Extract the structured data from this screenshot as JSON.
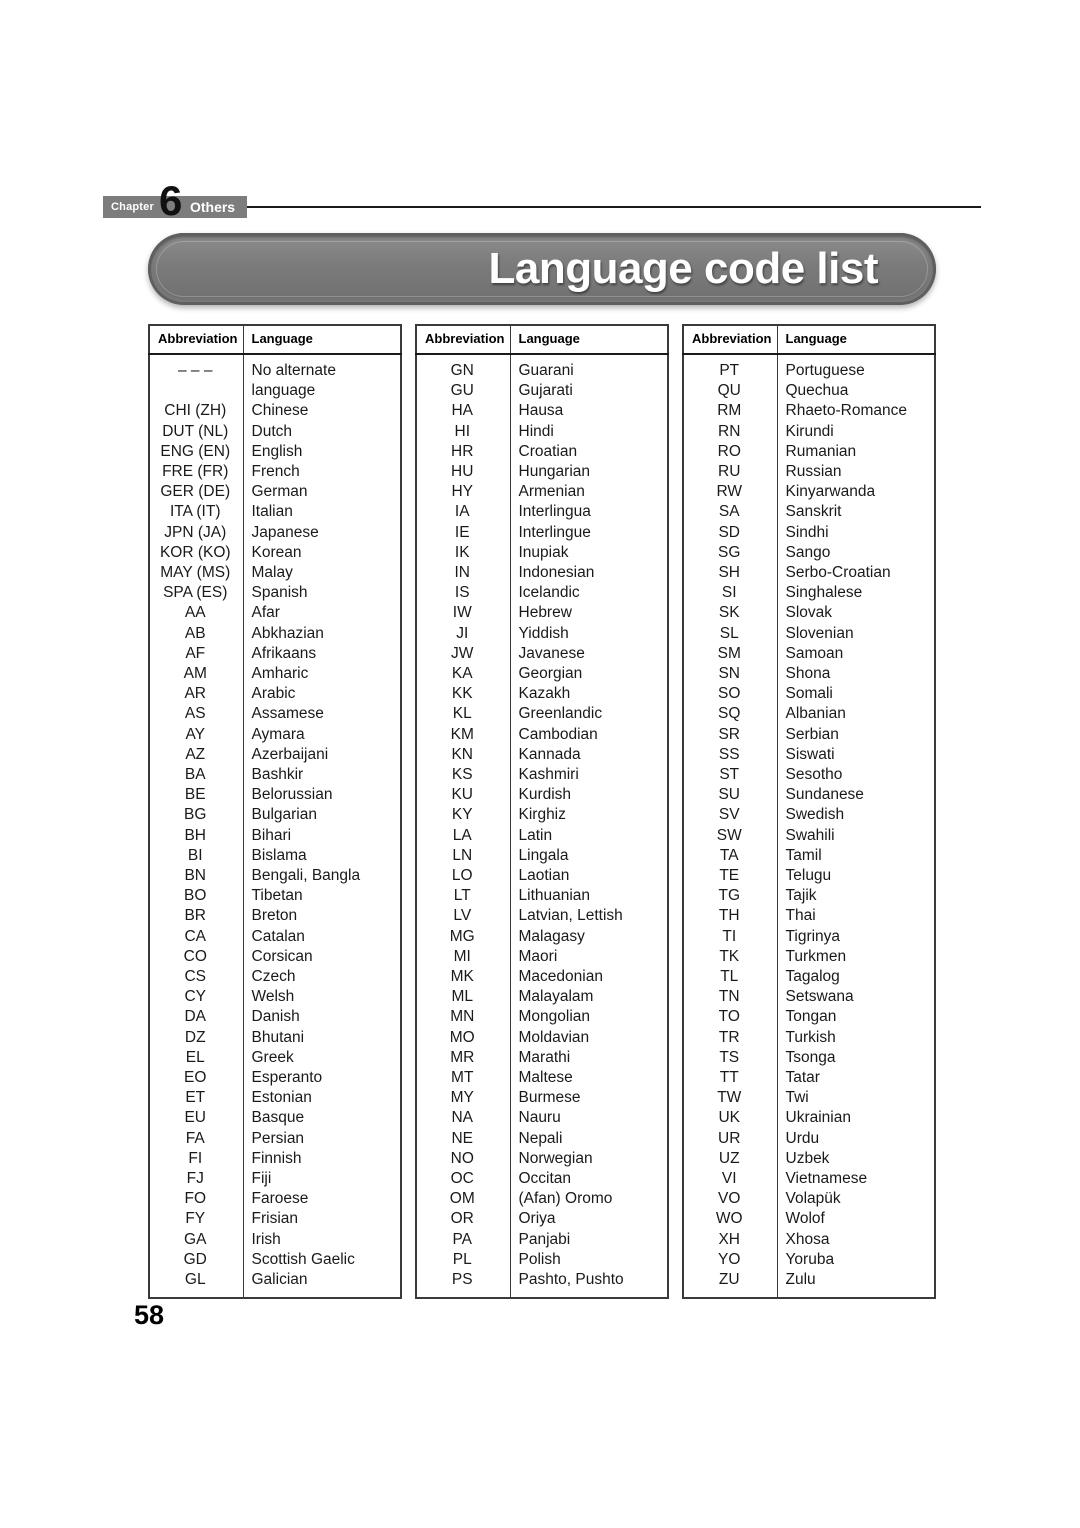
{
  "chapter": {
    "label": "Chapter",
    "number": "6",
    "section": "Others"
  },
  "page_title": "Language code list",
  "page_number": "58",
  "table_headers": {
    "abbreviation": "Abbreviation",
    "language": "Language"
  },
  "columns": [
    {
      "rows": [
        {
          "abbr": "– – –",
          "lang": "No alternate"
        },
        {
          "abbr": "",
          "lang": "language"
        },
        {
          "abbr": "CHI (ZH)",
          "lang": "Chinese"
        },
        {
          "abbr": "DUT (NL)",
          "lang": "Dutch"
        },
        {
          "abbr": "ENG (EN)",
          "lang": "English"
        },
        {
          "abbr": "FRE (FR)",
          "lang": "French"
        },
        {
          "abbr": "GER (DE)",
          "lang": "German"
        },
        {
          "abbr": "ITA (IT)",
          "lang": "Italian"
        },
        {
          "abbr": "JPN (JA)",
          "lang": "Japanese"
        },
        {
          "abbr": "KOR (KO)",
          "lang": "Korean"
        },
        {
          "abbr": "MAY (MS)",
          "lang": "Malay"
        },
        {
          "abbr": "SPA (ES)",
          "lang": "Spanish"
        },
        {
          "abbr": "AA",
          "lang": "Afar"
        },
        {
          "abbr": "AB",
          "lang": "Abkhazian"
        },
        {
          "abbr": "AF",
          "lang": "Afrikaans"
        },
        {
          "abbr": "AM",
          "lang": "Amharic"
        },
        {
          "abbr": "AR",
          "lang": "Arabic"
        },
        {
          "abbr": "AS",
          "lang": "Assamese"
        },
        {
          "abbr": "AY",
          "lang": "Aymara"
        },
        {
          "abbr": "AZ",
          "lang": "Azerbaijani"
        },
        {
          "abbr": "BA",
          "lang": "Bashkir"
        },
        {
          "abbr": "BE",
          "lang": "Belorussian"
        },
        {
          "abbr": "BG",
          "lang": "Bulgarian"
        },
        {
          "abbr": "BH",
          "lang": "Bihari"
        },
        {
          "abbr": "BI",
          "lang": "Bislama"
        },
        {
          "abbr": "BN",
          "lang": "Bengali, Bangla"
        },
        {
          "abbr": "BO",
          "lang": "Tibetan"
        },
        {
          "abbr": "BR",
          "lang": "Breton"
        },
        {
          "abbr": "CA",
          "lang": "Catalan"
        },
        {
          "abbr": "CO",
          "lang": "Corsican"
        },
        {
          "abbr": "CS",
          "lang": "Czech"
        },
        {
          "abbr": "CY",
          "lang": "Welsh"
        },
        {
          "abbr": "DA",
          "lang": "Danish"
        },
        {
          "abbr": "DZ",
          "lang": "Bhutani"
        },
        {
          "abbr": "EL",
          "lang": "Greek"
        },
        {
          "abbr": "EO",
          "lang": "Esperanto"
        },
        {
          "abbr": "ET",
          "lang": "Estonian"
        },
        {
          "abbr": "EU",
          "lang": "Basque"
        },
        {
          "abbr": "FA",
          "lang": "Persian"
        },
        {
          "abbr": "FI",
          "lang": "Finnish"
        },
        {
          "abbr": "FJ",
          "lang": "Fiji"
        },
        {
          "abbr": "FO",
          "lang": "Faroese"
        },
        {
          "abbr": "FY",
          "lang": "Frisian"
        },
        {
          "abbr": "GA",
          "lang": "Irish"
        },
        {
          "abbr": "GD",
          "lang": "Scottish Gaelic"
        },
        {
          "abbr": "GL",
          "lang": "Galician"
        }
      ]
    },
    {
      "rows": [
        {
          "abbr": "GN",
          "lang": "Guarani"
        },
        {
          "abbr": "GU",
          "lang": "Gujarati"
        },
        {
          "abbr": "HA",
          "lang": "Hausa"
        },
        {
          "abbr": "HI",
          "lang": "Hindi"
        },
        {
          "abbr": "HR",
          "lang": "Croatian"
        },
        {
          "abbr": "HU",
          "lang": "Hungarian"
        },
        {
          "abbr": "HY",
          "lang": "Armenian"
        },
        {
          "abbr": "IA",
          "lang": "Interlingua"
        },
        {
          "abbr": "IE",
          "lang": "Interlingue"
        },
        {
          "abbr": "IK",
          "lang": "Inupiak"
        },
        {
          "abbr": "IN",
          "lang": "Indonesian"
        },
        {
          "abbr": "IS",
          "lang": "Icelandic"
        },
        {
          "abbr": "IW",
          "lang": "Hebrew"
        },
        {
          "abbr": "JI",
          "lang": "Yiddish"
        },
        {
          "abbr": "JW",
          "lang": "Javanese"
        },
        {
          "abbr": "KA",
          "lang": "Georgian"
        },
        {
          "abbr": "KK",
          "lang": "Kazakh"
        },
        {
          "abbr": "KL",
          "lang": "Greenlandic"
        },
        {
          "abbr": "KM",
          "lang": "Cambodian"
        },
        {
          "abbr": "KN",
          "lang": "Kannada"
        },
        {
          "abbr": "KS",
          "lang": "Kashmiri"
        },
        {
          "abbr": "KU",
          "lang": "Kurdish"
        },
        {
          "abbr": "KY",
          "lang": "Kirghiz"
        },
        {
          "abbr": "LA",
          "lang": "Latin"
        },
        {
          "abbr": "LN",
          "lang": "Lingala"
        },
        {
          "abbr": "LO",
          "lang": "Laotian"
        },
        {
          "abbr": "LT",
          "lang": "Lithuanian"
        },
        {
          "abbr": "LV",
          "lang": "Latvian, Lettish"
        },
        {
          "abbr": "MG",
          "lang": "Malagasy"
        },
        {
          "abbr": "MI",
          "lang": "Maori"
        },
        {
          "abbr": "MK",
          "lang": "Macedonian"
        },
        {
          "abbr": "ML",
          "lang": "Malayalam"
        },
        {
          "abbr": "MN",
          "lang": "Mongolian"
        },
        {
          "abbr": "MO",
          "lang": "Moldavian"
        },
        {
          "abbr": "MR",
          "lang": "Marathi"
        },
        {
          "abbr": "MT",
          "lang": "Maltese"
        },
        {
          "abbr": "MY",
          "lang": "Burmese"
        },
        {
          "abbr": "NA",
          "lang": "Nauru"
        },
        {
          "abbr": "NE",
          "lang": "Nepali"
        },
        {
          "abbr": "NO",
          "lang": "Norwegian"
        },
        {
          "abbr": "OC",
          "lang": "Occitan"
        },
        {
          "abbr": "OM",
          "lang": "(Afan) Oromo"
        },
        {
          "abbr": "OR",
          "lang": "Oriya"
        },
        {
          "abbr": "PA",
          "lang": "Panjabi"
        },
        {
          "abbr": "PL",
          "lang": "Polish"
        },
        {
          "abbr": "PS",
          "lang": "Pashto, Pushto"
        }
      ]
    },
    {
      "rows": [
        {
          "abbr": "PT",
          "lang": "Portuguese"
        },
        {
          "abbr": "QU",
          "lang": "Quechua"
        },
        {
          "abbr": "RM",
          "lang": "Rhaeto-Romance"
        },
        {
          "abbr": "RN",
          "lang": "Kirundi"
        },
        {
          "abbr": "RO",
          "lang": "Rumanian"
        },
        {
          "abbr": "RU",
          "lang": "Russian"
        },
        {
          "abbr": "RW",
          "lang": "Kinyarwanda"
        },
        {
          "abbr": "SA",
          "lang": "Sanskrit"
        },
        {
          "abbr": "SD",
          "lang": "Sindhi"
        },
        {
          "abbr": "SG",
          "lang": "Sango"
        },
        {
          "abbr": "SH",
          "lang": "Serbo-Croatian"
        },
        {
          "abbr": "SI",
          "lang": "Singhalese"
        },
        {
          "abbr": "SK",
          "lang": "Slovak"
        },
        {
          "abbr": "SL",
          "lang": "Slovenian"
        },
        {
          "abbr": "SM",
          "lang": "Samoan"
        },
        {
          "abbr": "SN",
          "lang": "Shona"
        },
        {
          "abbr": "SO",
          "lang": "Somali"
        },
        {
          "abbr": "SQ",
          "lang": "Albanian"
        },
        {
          "abbr": "SR",
          "lang": "Serbian"
        },
        {
          "abbr": "SS",
          "lang": "Siswati"
        },
        {
          "abbr": "ST",
          "lang": "Sesotho"
        },
        {
          "abbr": "SU",
          "lang": "Sundanese"
        },
        {
          "abbr": "SV",
          "lang": "Swedish"
        },
        {
          "abbr": "SW",
          "lang": "Swahili"
        },
        {
          "abbr": "TA",
          "lang": "Tamil"
        },
        {
          "abbr": "TE",
          "lang": "Telugu"
        },
        {
          "abbr": "TG",
          "lang": "Tajik"
        },
        {
          "abbr": "TH",
          "lang": "Thai"
        },
        {
          "abbr": "TI",
          "lang": "Tigrinya"
        },
        {
          "abbr": "TK",
          "lang": "Turkmen"
        },
        {
          "abbr": "TL",
          "lang": "Tagalog"
        },
        {
          "abbr": "TN",
          "lang": "Setswana"
        },
        {
          "abbr": "TO",
          "lang": "Tongan"
        },
        {
          "abbr": "TR",
          "lang": "Turkish"
        },
        {
          "abbr": "TS",
          "lang": "Tsonga"
        },
        {
          "abbr": "TT",
          "lang": "Tatar"
        },
        {
          "abbr": "TW",
          "lang": "Twi"
        },
        {
          "abbr": "UK",
          "lang": "Ukrainian"
        },
        {
          "abbr": "UR",
          "lang": "Urdu"
        },
        {
          "abbr": "UZ",
          "lang": "Uzbek"
        },
        {
          "abbr": "VI",
          "lang": "Vietnamese"
        },
        {
          "abbr": "VO",
          "lang": "Volapük"
        },
        {
          "abbr": "WO",
          "lang": "Wolof"
        },
        {
          "abbr": "XH",
          "lang": "Xhosa"
        },
        {
          "abbr": "YO",
          "lang": "Yoruba"
        },
        {
          "abbr": "ZU",
          "lang": "Zulu"
        }
      ]
    }
  ]
}
